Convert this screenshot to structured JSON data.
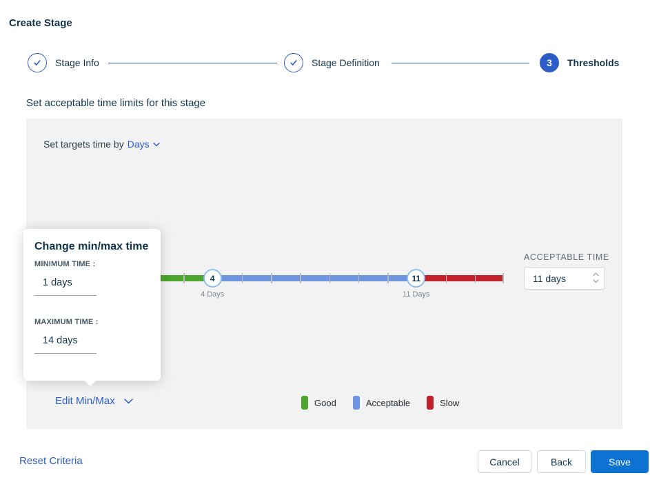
{
  "window": {
    "title": "Create Stage"
  },
  "stepper": {
    "steps": [
      {
        "label": "Stage Info",
        "state": "complete"
      },
      {
        "label": "Stage Definition",
        "state": "complete"
      },
      {
        "label": "Thresholds",
        "state": "active",
        "number": "3"
      }
    ]
  },
  "subtitle": "Set acceptable time limits for this stage",
  "targets": {
    "prefix": "Set targets time by",
    "selected_unit": "Days"
  },
  "slider": {
    "min_day": 1,
    "max_day": 14,
    "good_until_day": 4,
    "acceptable_until_day": 11,
    "markers": [
      {
        "day": 4,
        "value": "4",
        "label": "4 Days"
      },
      {
        "day": 11,
        "value": "11",
        "label": "11 Days"
      }
    ],
    "colors": {
      "good": "#4ca52e",
      "acceptable": "#6d96de",
      "slow": "#c4222a"
    }
  },
  "acceptable_time": {
    "label": "ACCEPTABLE TIME",
    "value": "11 days"
  },
  "edit_minmax": {
    "label": "Edit Min/Max"
  },
  "legend": {
    "items": [
      {
        "label": "Good",
        "color": "#4ca52e"
      },
      {
        "label": "Acceptable",
        "color": "#6d96de"
      },
      {
        "label": "Slow",
        "color": "#c4222a"
      }
    ]
  },
  "popup": {
    "title": "Change min/max time",
    "minimum": {
      "label": "MINIMUM TIME :",
      "value": "1 days"
    },
    "maximum": {
      "label": "MAXIMUM TIME :",
      "value": "14 days"
    }
  },
  "footer": {
    "reset_label": "Reset Criteria",
    "cancel_label": "Cancel",
    "back_label": "Back",
    "save_label": "Save"
  }
}
